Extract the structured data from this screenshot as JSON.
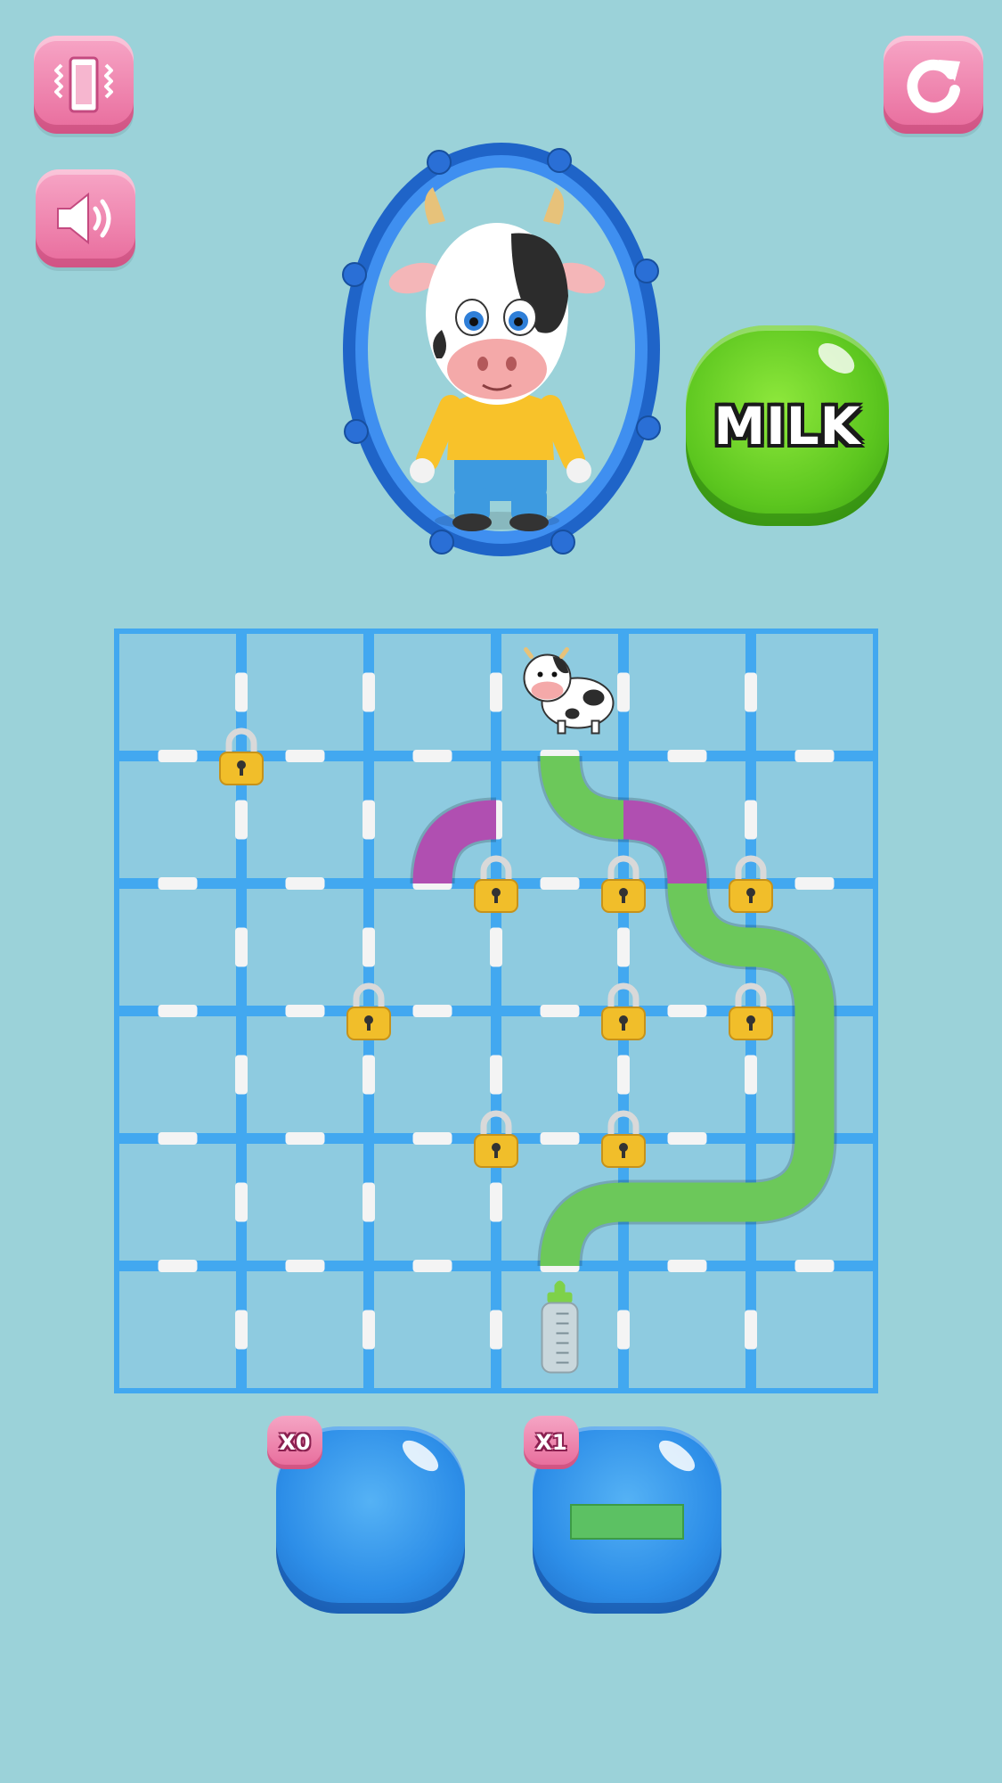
{
  "top_bar": {
    "vibrate_icon": "vibrate-icon",
    "sound_icon": "speaker-icon",
    "restart_icon": "restart-icon"
  },
  "character": {
    "name_icon": "cow-character-portrait"
  },
  "milk_button": {
    "label": "MILK",
    "color": "#5cc61f"
  },
  "board": {
    "rows": 6,
    "cols": 6,
    "start": {
      "row": 0,
      "col": 3,
      "icon": "cow-icon"
    },
    "goal": {
      "row": 5,
      "col": 3,
      "icon": "milk-bottle-icon"
    },
    "locks": [
      {
        "row": 1,
        "col": 1
      },
      {
        "row": 2,
        "col": 3
      },
      {
        "row": 2,
        "col": 4
      },
      {
        "row": 2,
        "col": 5
      },
      {
        "row": 3,
        "col": 2
      },
      {
        "row": 3,
        "col": 4
      },
      {
        "row": 3,
        "col": 5
      },
      {
        "row": 4,
        "col": 3
      },
      {
        "row": 4,
        "col": 4
      }
    ],
    "pipes": [
      {
        "row": 1,
        "col": 2,
        "type": "curve",
        "connects": [
          "bottom",
          "right"
        ],
        "color": "purple"
      },
      {
        "row": 1,
        "col": 3,
        "type": "curve",
        "connects": [
          "top",
          "right"
        ],
        "color": "green"
      },
      {
        "row": 1,
        "col": 4,
        "type": "curve",
        "connects": [
          "left",
          "bottom"
        ],
        "color": "purple"
      },
      {
        "row": 2,
        "col": 4,
        "type": "curve",
        "connects": [
          "top",
          "right"
        ],
        "color": "green"
      },
      {
        "row": 2,
        "col": 5,
        "type": "curve",
        "connects": [
          "left",
          "bottom"
        ],
        "color": "green"
      },
      {
        "row": 3,
        "col": 5,
        "type": "straight",
        "connects": [
          "top",
          "bottom"
        ],
        "color": "green"
      },
      {
        "row": 4,
        "col": 5,
        "type": "curve",
        "connects": [
          "top",
          "left"
        ],
        "color": "green"
      },
      {
        "row": 4,
        "col": 4,
        "type": "straight",
        "connects": [
          "left",
          "right"
        ],
        "color": "green"
      },
      {
        "row": 4,
        "col": 3,
        "type": "curve",
        "connects": [
          "right",
          "bottom"
        ],
        "color": "green"
      }
    ],
    "colors": {
      "cell": "#8ecbe0",
      "grid": "#42a8f0",
      "pipe_green": "#6cc85a",
      "pipe_purple": "#b04fb1"
    }
  },
  "tools": [
    {
      "id": "curve",
      "count_label": "X0",
      "piece": "empty"
    },
    {
      "id": "straight",
      "count_label": "X1",
      "piece": "straight-pipe"
    }
  ]
}
